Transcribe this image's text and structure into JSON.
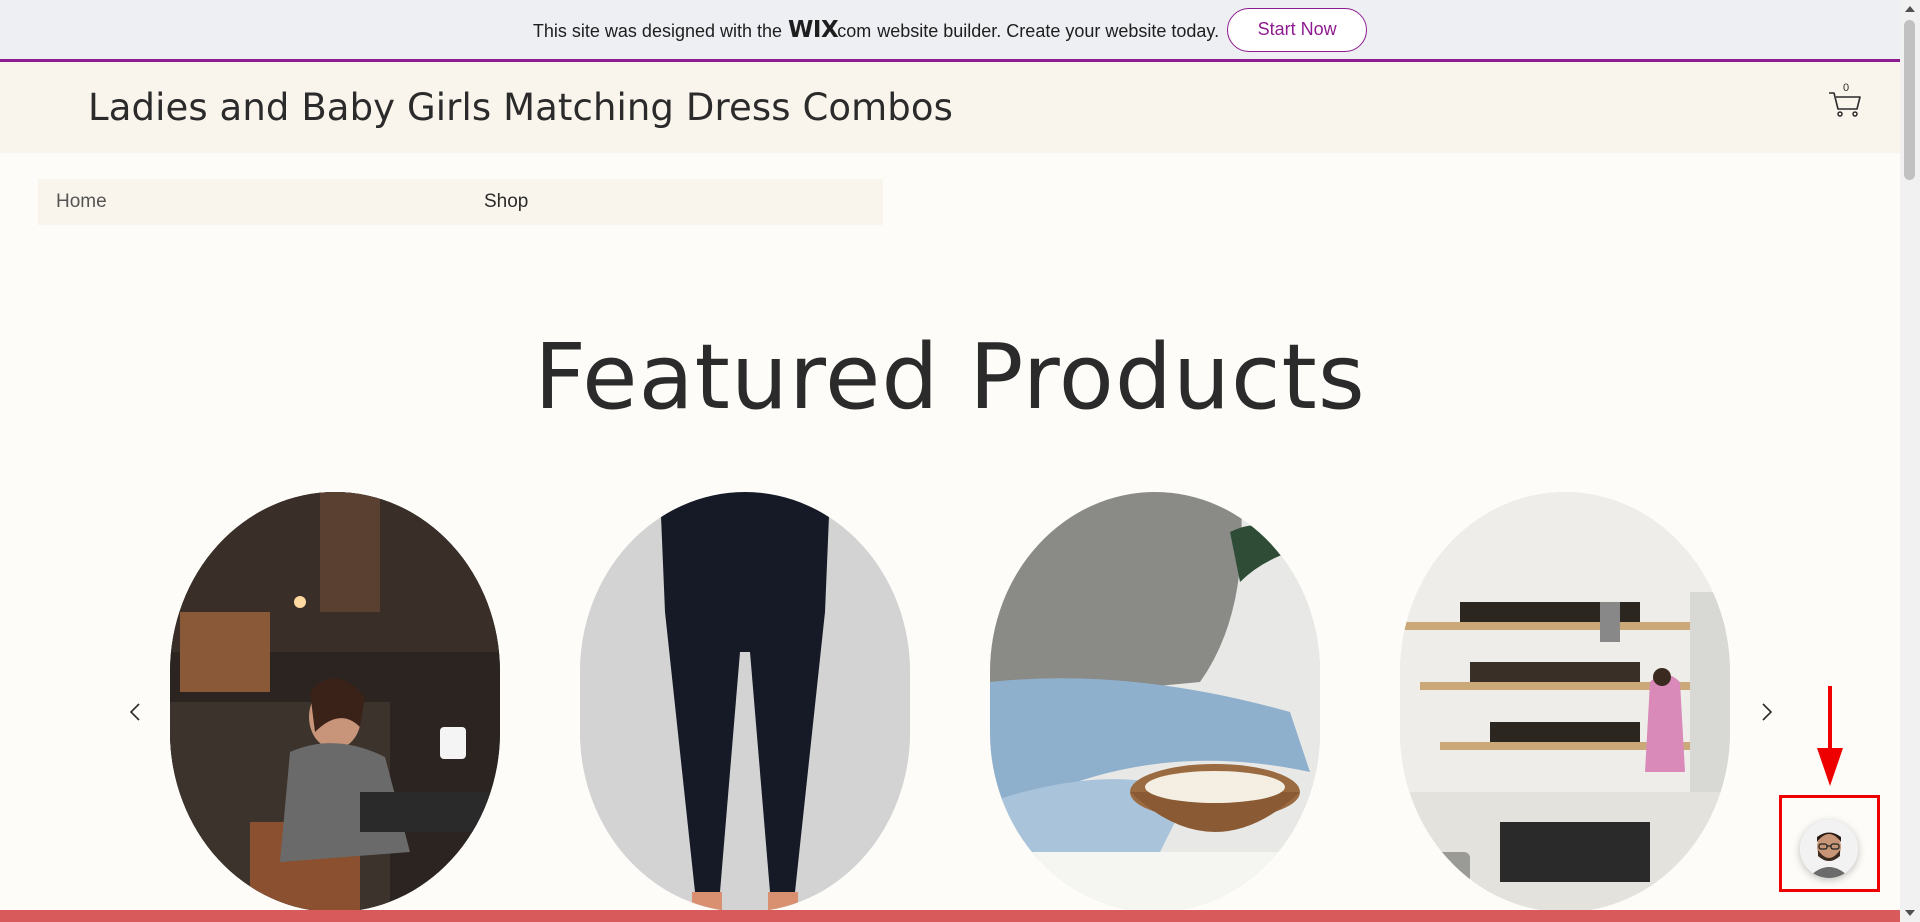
{
  "banner": {
    "text_before": "This site was designed with the",
    "logo_wix": "WIX",
    "logo_dotcom": ".com",
    "text_after": "website builder. Create your website today.",
    "cta_label": "Start Now",
    "accent_color": "#8e1b8f"
  },
  "header": {
    "site_title": "Ladies and Baby Girls Matching Dress Combos",
    "cart_count": "0",
    "cart_icon": "cart-icon"
  },
  "nav": {
    "items": [
      {
        "label": "Home"
      },
      {
        "label": "Shop"
      }
    ]
  },
  "main": {
    "heading": "Featured Products",
    "carousel": {
      "prev_icon": "chevron-left-icon",
      "next_icon": "chevron-right-icon",
      "products": [
        {
          "image": "woman-reading-by-fireplace"
        },
        {
          "image": "black-leggings"
        },
        {
          "image": "sweater-and-popcorn"
        },
        {
          "image": "shop-shelves-interior"
        }
      ]
    }
  },
  "chat_widget": {
    "icon": "avatar-icon",
    "annotation_color": "#ee0000"
  }
}
